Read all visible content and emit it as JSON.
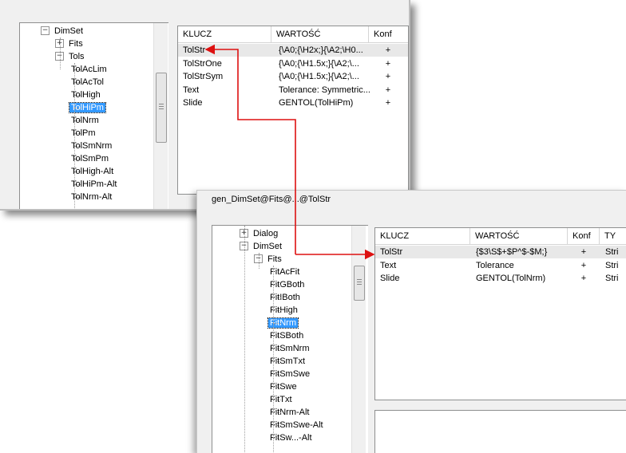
{
  "window1": {
    "tree": {
      "items": [
        {
          "label": "DimSet",
          "expander": "−"
        },
        {
          "label": "Fits",
          "expander": "+"
        },
        {
          "label": "Tols",
          "expander": "−"
        },
        {
          "label": "TolAcLim"
        },
        {
          "label": "TolAcTol"
        },
        {
          "label": "TolHigh"
        },
        {
          "label": "TolHiPm",
          "selected": true
        },
        {
          "label": "TolNrm"
        },
        {
          "label": "TolPm"
        },
        {
          "label": "TolSmNrm"
        },
        {
          "label": "TolSmPm"
        },
        {
          "label": "TolHigh-Alt"
        },
        {
          "label": "TolHiPm-Alt"
        },
        {
          "label": "TolNrm-Alt"
        }
      ]
    },
    "grid": {
      "columns": [
        "KLUCZ",
        "WARTOŚĆ",
        "Konf"
      ],
      "rows": [
        [
          "TolStr",
          "{\\A0;{\\H2x;}{\\A2;\\H0...",
          "+"
        ],
        [
          "TolStrOne",
          "{\\A0;{\\H1.5x;}{\\A2;\\...",
          "+"
        ],
        [
          "TolStrSym",
          "{\\A0;{\\H1.5x;}{\\A2;\\...",
          "+"
        ],
        [
          "Text",
          "Tolerance: Symmetric...",
          "+"
        ],
        [
          "Slide",
          "GENTOL(TolHiPm)",
          "+"
        ]
      ]
    }
  },
  "window2": {
    "title": "gen_DimSet@Fits@...@TolStr",
    "tree": {
      "items": [
        {
          "label": "Dialog",
          "expander": "+"
        },
        {
          "label": "DimSet",
          "expander": "−"
        },
        {
          "label": "Fits",
          "expander": "−"
        },
        {
          "label": "FitAcFit"
        },
        {
          "label": "FitGBoth"
        },
        {
          "label": "FitIBoth"
        },
        {
          "label": "FitHigh"
        },
        {
          "label": "FitNrm",
          "selected": true
        },
        {
          "label": "FitSBoth"
        },
        {
          "label": "FitSmNrm"
        },
        {
          "label": "FitSmTxt"
        },
        {
          "label": "FitSmSwe"
        },
        {
          "label": "FitSwe"
        },
        {
          "label": "FitTxt"
        },
        {
          "label": "FitNrm-Alt"
        },
        {
          "label": "FitSmSwe-Alt"
        },
        {
          "label": "FitSw...-Alt"
        }
      ]
    },
    "grid": {
      "columns": [
        "KLUCZ",
        "WARTOŚĆ",
        "Konf",
        "TY"
      ],
      "rows": [
        [
          "TolStr",
          "{$3\\S$+$P^$-$M;}",
          "+",
          "Stri"
        ],
        [
          "Text",
          "Tolerance",
          "+",
          "Stri"
        ],
        [
          "Slide",
          "GENTOL(TolNrm)",
          "+",
          "Stri"
        ]
      ]
    }
  },
  "colors": {
    "arrow": "#dd1111",
    "selection": "#3399ff"
  }
}
